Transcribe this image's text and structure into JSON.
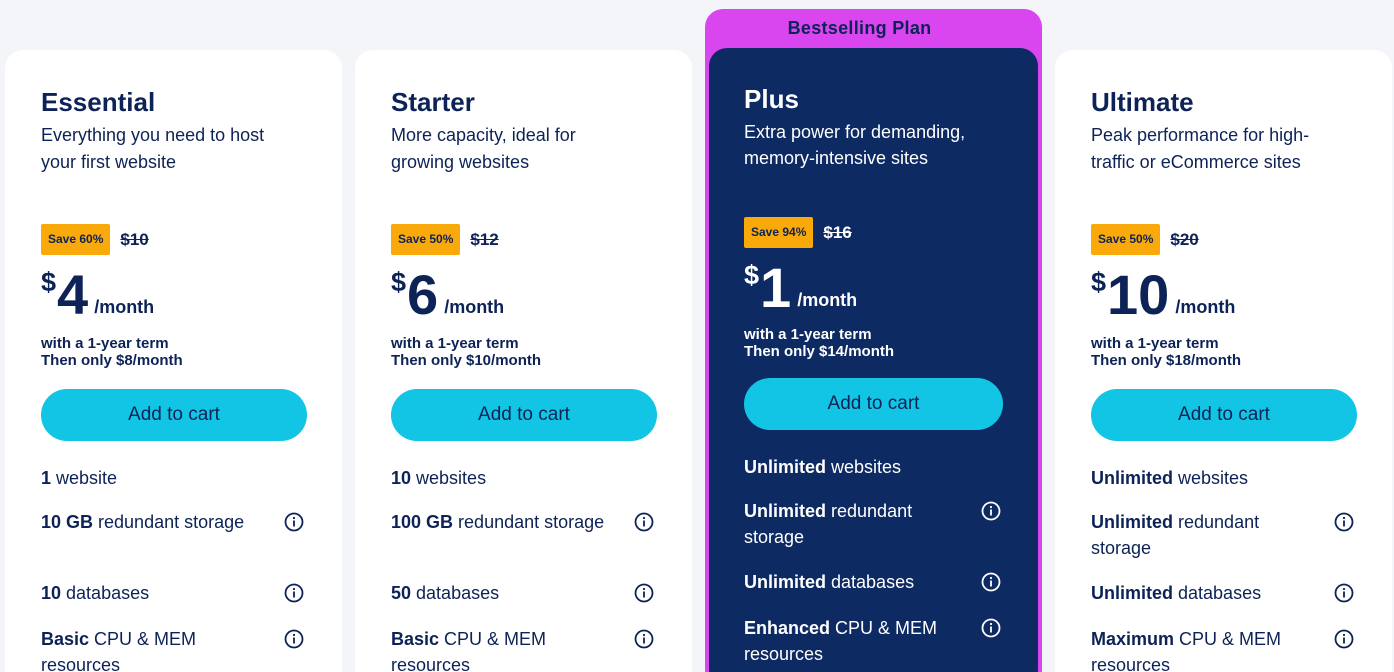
{
  "ribbon": "Bestselling Plan",
  "plans": [
    {
      "name": "Essential",
      "desc": "Everything you need to host your first website",
      "save": "Save 60%",
      "old_price": "$10",
      "currency": "$",
      "amount": "4",
      "per": "/month",
      "term1": "with a 1-year term",
      "term2": "Then only $8/month",
      "cta": "Add to cart",
      "features": [
        {
          "strong": "1",
          "rest": " website"
        },
        {
          "strong": "10 GB",
          "rest": " redundant storage"
        },
        {
          "strong": "10",
          "rest": " databases"
        },
        {
          "strong": "Basic",
          "rest": " CPU & MEM resources"
        }
      ]
    },
    {
      "name": "Starter",
      "desc": "More capacity, ideal for growing websites",
      "save": "Save 50%",
      "old_price": "$12",
      "currency": "$",
      "amount": "6",
      "per": "/month",
      "term1": "with a 1-year term",
      "term2": "Then only $10/month",
      "cta": "Add to cart",
      "features": [
        {
          "strong": "10",
          "rest": " websites"
        },
        {
          "strong": "100 GB",
          "rest": " redundant storage"
        },
        {
          "strong": "50",
          "rest": " databases"
        },
        {
          "strong": "Basic",
          "rest": " CPU & MEM resources"
        }
      ]
    },
    {
      "name": "Plus",
      "desc": "Extra power for demanding, memory-intensive sites",
      "save": "Save 94%",
      "old_price": "$16",
      "currency": "$",
      "amount": "1",
      "per": "/month",
      "term1": "with a 1-year term",
      "term2": "Then only $14/month",
      "cta": "Add to cart",
      "features": [
        {
          "strong": "Unlimited",
          "rest": " websites"
        },
        {
          "strong": "Unlimited",
          "rest": " redundant storage"
        },
        {
          "strong": "Unlimited",
          "rest": " databases"
        },
        {
          "strong": "Enhanced",
          "rest": " CPU & MEM resources"
        }
      ]
    },
    {
      "name": "Ultimate",
      "desc": "Peak performance for high-traffic or eCommerce sites",
      "save": "Save 50%",
      "old_price": "$20",
      "currency": "$",
      "amount": "10",
      "per": "/month",
      "term1": "with a 1-year term",
      "term2": "Then only $18/month",
      "cta": "Add to cart",
      "features": [
        {
          "strong": "Unlimited",
          "rest": " websites"
        },
        {
          "strong": "Unlimited",
          "rest": " redundant storage"
        },
        {
          "strong": "Unlimited",
          "rest": " databases"
        },
        {
          "strong": "Maximum",
          "rest": " CPU & MEM resources"
        }
      ]
    }
  ],
  "icons": {
    "info": "info-circle-icon"
  },
  "colors": {
    "badge": "#f9a90a",
    "button": "#12c5e4",
    "featured_card": "#0d2a63",
    "featured_border": "#d946ef",
    "text": "#0d2256"
  }
}
